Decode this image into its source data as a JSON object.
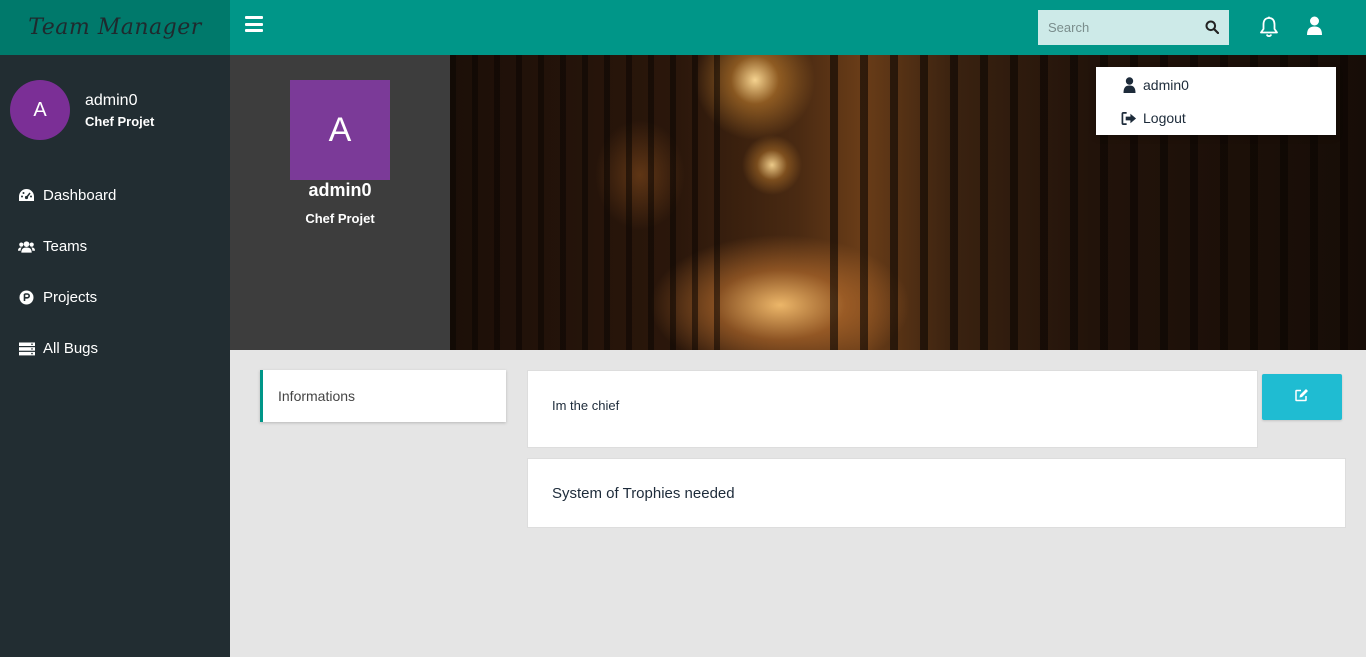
{
  "app": {
    "logo_text": "Team Manager"
  },
  "sidebar": {
    "user": {
      "avatar_letter": "A",
      "name": "admin0",
      "role": "Chef Projet"
    },
    "items": [
      {
        "label": "Dashboard",
        "icon": "dashboard-icon"
      },
      {
        "label": "Teams",
        "icon": "users-icon"
      },
      {
        "label": "Projects",
        "icon": "product-hunt-icon"
      },
      {
        "label": "All Bugs",
        "icon": "server-icon"
      }
    ]
  },
  "topbar": {
    "search": {
      "placeholder": "Search",
      "value": ""
    }
  },
  "dropdown": {
    "username": "admin0",
    "logout_label": "Logout"
  },
  "profile": {
    "avatar_letter": "A",
    "name": "admin0",
    "role": "Chef Projet"
  },
  "content": {
    "tab_label": "Informations",
    "bio": "Im the chief",
    "note": "System of Trophies needed"
  },
  "colors": {
    "topbar": "#009688",
    "logo_bg": "#00796b",
    "sidebar": "#222d32",
    "avatar": "#7b2f96",
    "edit_button": "#1fbcd2"
  }
}
